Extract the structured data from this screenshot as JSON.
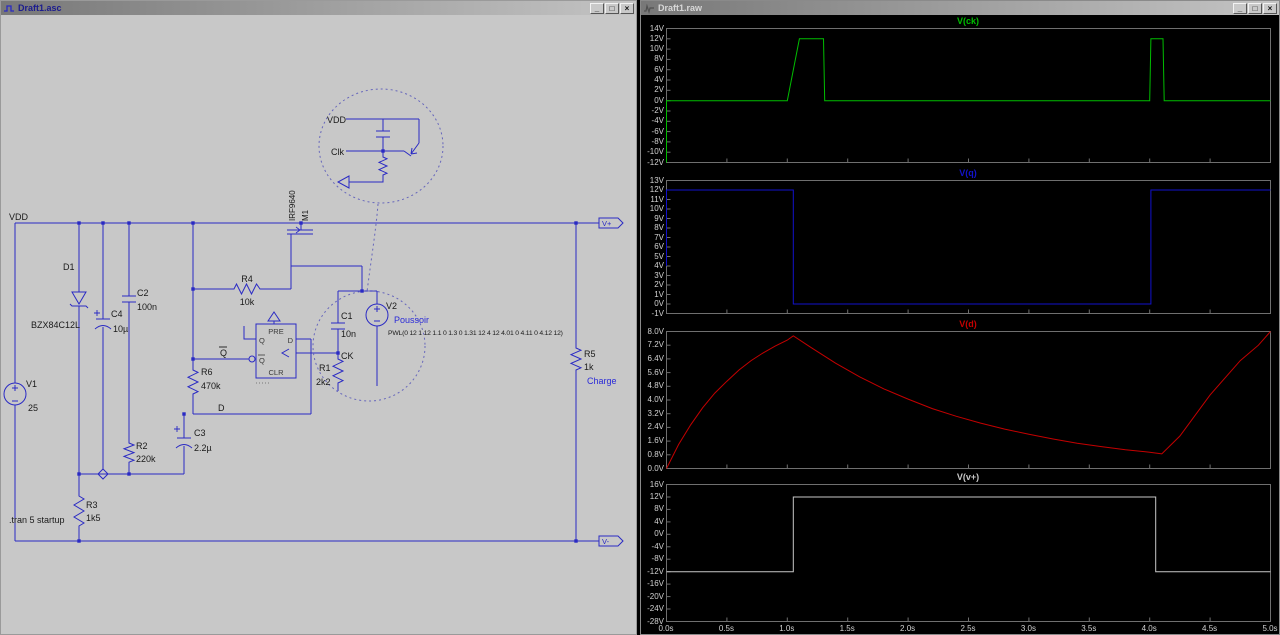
{
  "left_window": {
    "title": "Draft1.asc"
  },
  "right_window": {
    "title": "Draft1.raw"
  },
  "window_controls": {
    "minimize": "_",
    "maximize": "□",
    "close": "×"
  },
  "schematic": {
    "labels": {
      "vdd": "VDD",
      "v1_name": "V1",
      "v1_value": "25",
      "d1_name": "D1",
      "d1_value": "BZX84C12L",
      "c4_name": "C4",
      "c4_value": "10µ",
      "c2_name": "C2",
      "c2_value": "100n",
      "r2_name": "R2",
      "r2_value": "220k",
      "r3_name": "R3",
      "r3_value": "1k5",
      "tran_directive": ".tran 5 startup",
      "c3_name": "C3",
      "c3_value": "2.2µ",
      "r6_name": "R6",
      "r6_value": "470k",
      "r4_name": "R4",
      "r4_value": "10k",
      "ff_pre": "PRE",
      "ff_q": "Q",
      "ff_qbar": "Q",
      "ff_d": "D",
      "ff_clr": "CLR",
      "net_qbar": "Q",
      "net_d": "D",
      "net_ck": "CK",
      "m1_model": "IRF9640",
      "m1_name": "M1",
      "c1_name": "C1",
      "c1_value": "10n",
      "r1_name": "R1",
      "r1_value": "2k2",
      "v2_name": "V2",
      "v2_comment": "Poussoir",
      "v2_value": "PWL(0 12 1 12 1.1 0 1.3 0 1.31 12 4 12 4.01 0 4.11 0 4.12 12)",
      "r5_name": "R5",
      "r5_value": "1k",
      "charge_comment": "Charge",
      "port_vplus": "V+",
      "port_vminus": "V-",
      "inset_vdd": "VDD",
      "inset_clk": "Clk"
    }
  },
  "chart_data": {
    "type": "line",
    "xlabel": "time",
    "xlim": [
      0,
      5
    ],
    "xtick_values": [
      0,
      0.5,
      1,
      1.5,
      2,
      2.5,
      3,
      3.5,
      4,
      4.5,
      5
    ],
    "xtick_labels": [
      "0.0s",
      "0.5s",
      "1.0s",
      "1.5s",
      "2.0s",
      "2.5s",
      "3.0s",
      "3.5s",
      "4.0s",
      "4.5s",
      "5.0s"
    ],
    "panes": [
      {
        "name": "V(ck)",
        "color": "#00bd00",
        "ylim": [
          -12,
          14
        ],
        "ytick_values": [
          14,
          12,
          10,
          8,
          6,
          4,
          2,
          0,
          -2,
          -4,
          -6,
          -8,
          -10,
          -12
        ],
        "ytick_labels": [
          "14V",
          "12V",
          "10V",
          "8V",
          "6V",
          "4V",
          "2V",
          "0V",
          "-2V",
          "-4V",
          "-6V",
          "-8V",
          "-10V",
          "-12V"
        ],
        "points": [
          [
            0,
            -12
          ],
          [
            0,
            0
          ],
          [
            1.0,
            0
          ],
          [
            1.1,
            12
          ],
          [
            1.3,
            12
          ],
          [
            1.31,
            0
          ],
          [
            4.0,
            0
          ],
          [
            4.01,
            12
          ],
          [
            4.11,
            12
          ],
          [
            4.12,
            0
          ],
          [
            5,
            0
          ]
        ]
      },
      {
        "name": "V(q)",
        "color": "#1212cc",
        "ylim": [
          -1,
          13
        ],
        "ytick_values": [
          13,
          12,
          11,
          10,
          9,
          8,
          7,
          6,
          5,
          4,
          3,
          2,
          1,
          0,
          -1
        ],
        "ytick_labels": [
          "13V",
          "12V",
          "11V",
          "10V",
          "9V",
          "8V",
          "7V",
          "6V",
          "5V",
          "4V",
          "3V",
          "2V",
          "1V",
          "0V",
          "-1V"
        ],
        "points": [
          [
            0,
            4
          ],
          [
            0,
            12
          ],
          [
            1.05,
            12
          ],
          [
            1.05,
            0
          ],
          [
            4.01,
            0
          ],
          [
            4.01,
            12
          ],
          [
            5,
            12
          ]
        ]
      },
      {
        "name": "V(d)",
        "color": "#c40000",
        "ylim": [
          0,
          8
        ],
        "ytick_values": [
          8.0,
          7.2,
          6.4,
          5.6,
          4.8,
          4.0,
          3.2,
          2.4,
          1.6,
          0.8,
          0.0
        ],
        "ytick_labels": [
          "8.0V",
          "7.2V",
          "6.4V",
          "5.6V",
          "4.8V",
          "4.0V",
          "3.2V",
          "2.4V",
          "1.6V",
          "0.8V",
          "0.0V"
        ],
        "points": [
          [
            0,
            0
          ],
          [
            0.1,
            1.4
          ],
          [
            0.2,
            2.55
          ],
          [
            0.3,
            3.55
          ],
          [
            0.4,
            4.4
          ],
          [
            0.5,
            5.1
          ],
          [
            0.6,
            5.75
          ],
          [
            0.7,
            6.3
          ],
          [
            0.8,
            6.75
          ],
          [
            0.9,
            7.15
          ],
          [
            1.0,
            7.5
          ],
          [
            1.05,
            7.75
          ],
          [
            1.2,
            7.05
          ],
          [
            1.4,
            6.15
          ],
          [
            1.6,
            5.35
          ],
          [
            1.8,
            4.65
          ],
          [
            2.0,
            4.05
          ],
          [
            2.2,
            3.5
          ],
          [
            2.4,
            3.05
          ],
          [
            2.6,
            2.65
          ],
          [
            2.8,
            2.3
          ],
          [
            3.0,
            2.0
          ],
          [
            3.2,
            1.72
          ],
          [
            3.4,
            1.48
          ],
          [
            3.6,
            1.28
          ],
          [
            3.8,
            1.1
          ],
          [
            4.0,
            0.95
          ],
          [
            4.1,
            0.85
          ],
          [
            4.25,
            1.9
          ],
          [
            4.5,
            4.3
          ],
          [
            4.75,
            6.3
          ],
          [
            4.9,
            7.2
          ],
          [
            5.0,
            8.0
          ]
        ]
      },
      {
        "name": "V(v+)",
        "color": "#c8c8c8",
        "ylim": [
          -28,
          16
        ],
        "ytick_values": [
          16,
          12,
          8,
          4,
          0,
          -4,
          -8,
          -12,
          -16,
          -20,
          -24,
          -28
        ],
        "ytick_labels": [
          "16V",
          "12V",
          "8V",
          "4V",
          "0V",
          "-4V",
          "-8V",
          "-12V",
          "-16V",
          "-20V",
          "-24V",
          "-28V"
        ],
        "points": [
          [
            0,
            -12
          ],
          [
            1.05,
            -12
          ],
          [
            1.05,
            12
          ],
          [
            4.05,
            12
          ],
          [
            4.05,
            -12
          ],
          [
            5,
            -12
          ]
        ]
      }
    ]
  }
}
